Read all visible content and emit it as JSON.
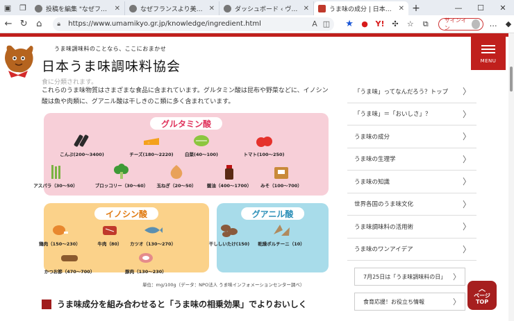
{
  "browser": {
    "tabs": [
      {
        "title": "投稿を編集 \"なぜフランスより美味"
      },
      {
        "title": "なぜフランスより美味しいマリアー"
      },
      {
        "title": "ダッシュボード ‹ ヴィンテージワイン"
      },
      {
        "title": "うま味の成分 | 日本うま味調味料協"
      }
    ],
    "url": "https://www.umamikyo.gr.jp/knowledge/ingredient.html",
    "signin_label": "サインイン"
  },
  "site": {
    "tagline": "うま味調味料のことなら、ここにおまかせ",
    "name": "日本うま味調味料協会",
    "menu_label": "MENU"
  },
  "content": {
    "faded_line": "食に分類されます。",
    "paragraph": "これらのうま味物質はさまざまな食品に含まれています。グルタミン酸は昆布や野菜などに、イノシン酸は魚や肉類に、グアニル酸は干しきのこ類に多く含まれています。",
    "unit_note": "単位：mg/100g（データ：NPO法人 うま味インフォメーションセンター調べ）",
    "section_heading": "うま味成分を組み合わせると「うま味の相乗効果」でよりおいしく"
  },
  "infographic": {
    "glutamate": {
      "title": "グルタミン酸",
      "items": [
        {
          "label": "こんぶ(200～3400)",
          "icon": "kelp-icon",
          "color": "#2a2a2a"
        },
        {
          "label": "チーズ(180～2220)",
          "icon": "cheese-icon",
          "color": "#f4a11c"
        },
        {
          "label": "白菜(40～100)",
          "icon": "napa-cabbage-icon",
          "color": "#8cc63f"
        },
        {
          "label": "トマト(100～250)",
          "icon": "tomato-icon",
          "color": "#e5322c"
        },
        {
          "label": "アスパラ（30～50）",
          "icon": "asparagus-icon",
          "color": "#7bb342"
        },
        {
          "label": "ブロッコリー（30～60）",
          "icon": "broccoli-icon",
          "color": "#3e9a36"
        },
        {
          "label": "玉ねぎ（20～50）",
          "icon": "onion-icon",
          "color": "#e8a25a"
        },
        {
          "label": "醤油（400～1700）",
          "icon": "soy-sauce-icon",
          "color": "#5a2a14"
        },
        {
          "label": "みそ（100～700）",
          "icon": "miso-icon",
          "color": "#c98a3a"
        }
      ]
    },
    "inosinate": {
      "title": "イノシン酸",
      "items": [
        {
          "label": "鶏肉（150～230）",
          "icon": "chicken-icon",
          "color": "#e8872e"
        },
        {
          "label": "牛肉（80）",
          "icon": "beef-icon",
          "color": "#c0392b"
        },
        {
          "label": "カツオ（130～270）",
          "icon": "bonito-icon",
          "color": "#5b8fb0"
        },
        {
          "label": "かつお節（470～700）",
          "icon": "katsuobushi-icon",
          "color": "#8a5a2e"
        },
        {
          "label": "豚肉（130～230）",
          "icon": "pork-icon",
          "color": "#e58b8b"
        }
      ]
    },
    "guanylate": {
      "title": "グアニル酸",
      "items": [
        {
          "label": "干ししいたけ(150)",
          "icon": "dried-shiitake-icon",
          "color": "#8a5a3c"
        },
        {
          "label": "乾燥ポルチーニ（10）",
          "icon": "dried-porcini-icon",
          "color": "#b08a5e"
        }
      ]
    }
  },
  "sidebar": {
    "items": [
      {
        "label": "「うま味」ってなんだろう？トップ"
      },
      {
        "label": "「うま味」＝「おいしさ」？"
      },
      {
        "label": "うま味の成分"
      },
      {
        "label": "うま味の生理学"
      },
      {
        "label": "うま味の知識"
      },
      {
        "label": "世界各国のうま味文化"
      },
      {
        "label": "うま味調味料の活用術"
      },
      {
        "label": "うま味のワンアイデア"
      }
    ],
    "banners": [
      {
        "label": "7月25日は「うま味調味料の日」"
      },
      {
        "label": "食育応援！お役立ち情報"
      }
    ]
  },
  "pagetop": {
    "line1": "ページ",
    "line2": "TOP"
  }
}
